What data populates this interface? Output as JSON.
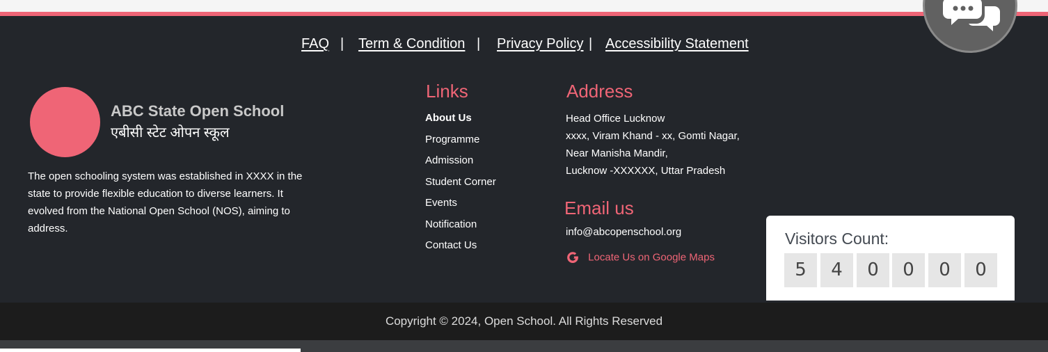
{
  "nav": {
    "faq": "FAQ",
    "terms": "Term & Condition",
    "privacy": "Privacy Policy",
    "accessibility": "Accessibility Statement",
    "separator": "|"
  },
  "school": {
    "name_en": "ABC State Open School",
    "name_hi": "एबीसी स्टेट ओपन स्कूल",
    "about": "The open schooling system was established in XXXX in the state to provide flexible education to diverse learners. It evolved from the National Open School (NOS), aiming to address."
  },
  "links": {
    "heading": "Links",
    "items": [
      "About Us",
      "Programme",
      "Admission",
      "Student Corner",
      "Events",
      "Notification",
      "Contact Us"
    ]
  },
  "address": {
    "heading": "Address",
    "lines": [
      "Head Office Lucknow",
      "xxxx, Viram Khand - xx, Gomti Nagar,",
      "Near Manisha Mandir,",
      "Lucknow -XXXXXX, Uttar Pradesh"
    ]
  },
  "email": {
    "heading": "Email us",
    "value": "info@abcopenschool.org",
    "maps_label": "Locate Us on Google Maps",
    "maps_icon": "google-icon"
  },
  "visitors": {
    "label": "Visitors Count:",
    "digits": [
      "5",
      "4",
      "0",
      "0",
      "0",
      "0"
    ]
  },
  "footer": {
    "copyright": "Copyright © 2024, Open School. All Rights Reserved"
  },
  "chat": {
    "icon": "chat-bubbles-icon"
  },
  "colors": {
    "accent": "#ef6576",
    "background": "#23262b",
    "copyright_bg": "#1c1c1c"
  }
}
